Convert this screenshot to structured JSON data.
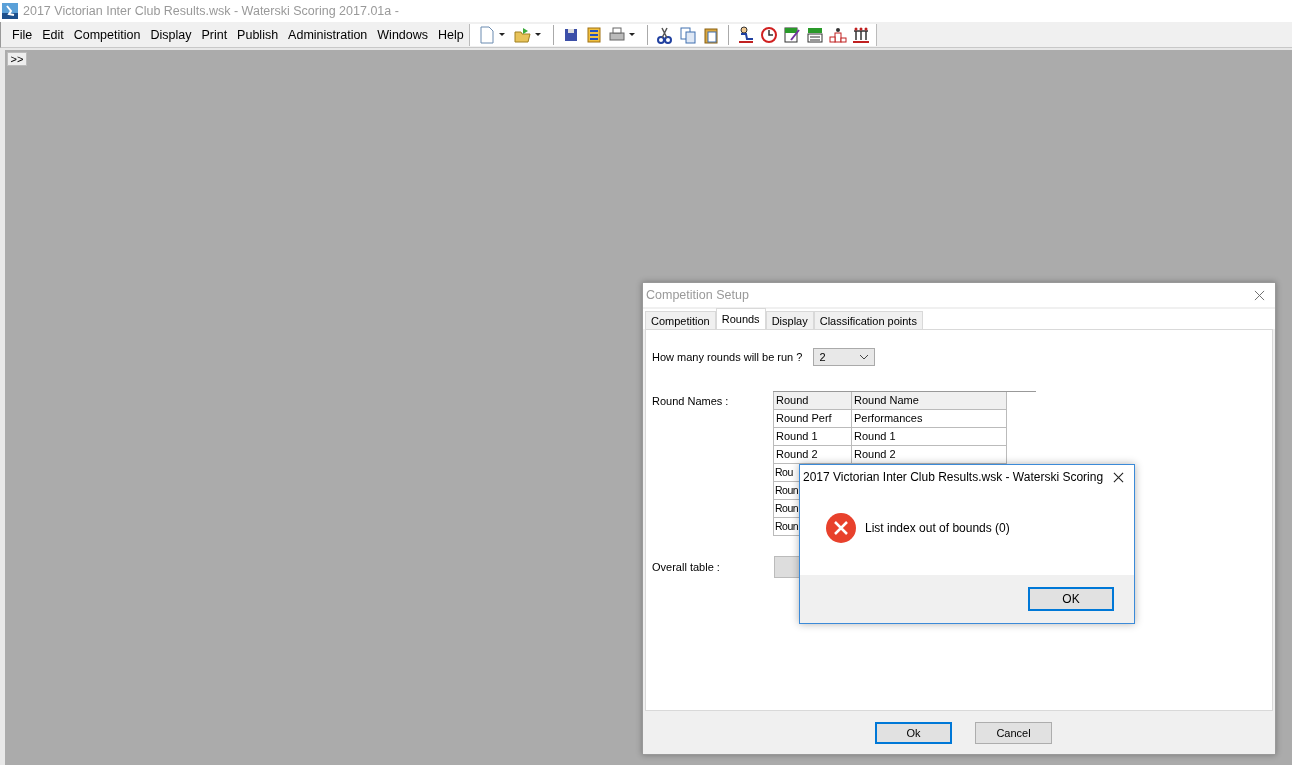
{
  "window": {
    "title": "2017 Victorian Inter Club Results.wsk - Waterski Scoring 2017.01a  -"
  },
  "menu": [
    "File",
    "Edit",
    "Competition",
    "Display",
    "Print",
    "Publish",
    "Administration",
    "Windows",
    "Help"
  ],
  "mdi": {
    "toggle": ">>"
  },
  "dialog": {
    "title": "Competition Setup",
    "tabs": [
      {
        "label": "Competition",
        "selected": false
      },
      {
        "label": "Rounds",
        "selected": true
      },
      {
        "label": "Display",
        "selected": false
      },
      {
        "label": "Classification points",
        "selected": false
      }
    ],
    "rounds_label": "How many rounds will be run ?",
    "rounds_value": "2",
    "round_names_label": "Round Names :",
    "columns": [
      "Round",
      "Round Name"
    ],
    "rows": [
      {
        "round": "Round Perf",
        "name": "Performances"
      },
      {
        "round": "Round 1",
        "name": "Round 1"
      },
      {
        "round": "Round 2",
        "name": "Round 2"
      },
      {
        "round": "Rou"
      },
      {
        "round": "Roun"
      },
      {
        "round": "Roun"
      },
      {
        "round": "Roun"
      }
    ],
    "overall_label": "Overall table :",
    "buttons": [
      "Ok",
      "Cancel"
    ]
  },
  "message": {
    "title": "2017 Victorian Inter Club Results.wsk - Waterski Scoring",
    "text": "List index out of bounds (0)",
    "button": "OK"
  }
}
